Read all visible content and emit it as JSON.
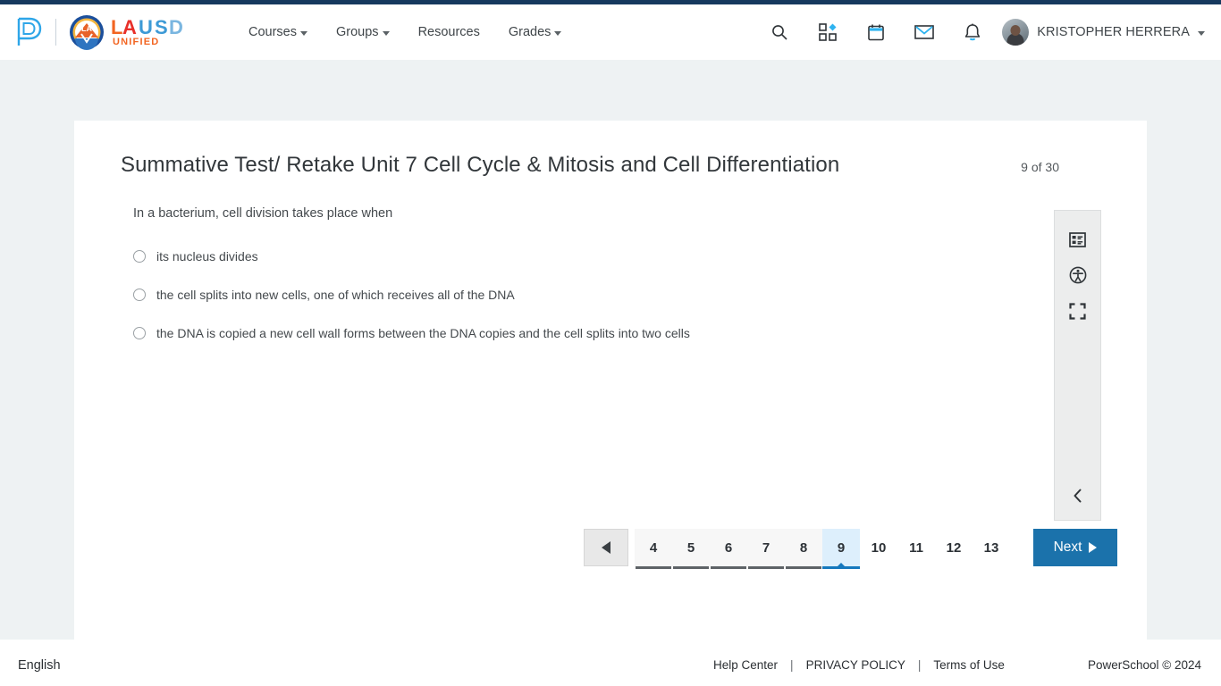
{
  "header": {
    "brand": {
      "powerschool_logo": "powerschool-p-logo",
      "district_logo": "lausd-unified-logo",
      "district_name_primary": "LA",
      "district_name_secondary": "USD",
      "district_tagline": "UNIFIED"
    },
    "nav": [
      {
        "label": "Courses",
        "has_caret": true
      },
      {
        "label": "Groups",
        "has_caret": true
      },
      {
        "label": "Resources",
        "has_caret": false
      },
      {
        "label": "Grades",
        "has_caret": true
      }
    ],
    "icons": [
      {
        "name": "search-icon",
        "title": "Search"
      },
      {
        "name": "apps-grid-icon",
        "title": "Apps"
      },
      {
        "name": "calendar-icon",
        "title": "Calendar"
      },
      {
        "name": "mail-icon",
        "title": "Messages"
      },
      {
        "name": "bell-icon",
        "title": "Notifications"
      }
    ],
    "user": {
      "name": "KRISTOPHER HERRERA",
      "avatar": "user-avatar"
    }
  },
  "quiz": {
    "title": "Summative Test/ Retake Unit 7 Cell Cycle & Mitosis and Cell Differentiation",
    "progress": "9 of 30",
    "current_question": 9,
    "total_questions": 30,
    "question_text": "In a bacterium, cell division takes place when",
    "options": [
      {
        "label": "its nucleus divides",
        "selected": false
      },
      {
        "label": "the cell splits into new cells, one of which receives all of the DNA",
        "selected": false
      },
      {
        "label": "the DNA is copied a new cell wall forms between the DNA copies and the cell splits into two cells",
        "selected": false
      }
    ]
  },
  "tool_rail": {
    "buttons": [
      {
        "name": "question-list-icon",
        "title": "Question list"
      },
      {
        "name": "accessibility-icon",
        "title": "Accessibility"
      },
      {
        "name": "fullscreen-icon",
        "title": "Fullscreen"
      }
    ],
    "collapse": {
      "name": "chevron-left-icon",
      "title": "Collapse panel"
    }
  },
  "pagination": {
    "prev_label": "prev-arrow",
    "pages": [
      {
        "number": "4",
        "state": "answered"
      },
      {
        "number": "5",
        "state": "answered"
      },
      {
        "number": "6",
        "state": "answered"
      },
      {
        "number": "7",
        "state": "answered"
      },
      {
        "number": "8",
        "state": "answered"
      },
      {
        "number": "9",
        "state": "current"
      },
      {
        "number": "10",
        "state": "plain"
      },
      {
        "number": "11",
        "state": "plain"
      },
      {
        "number": "12",
        "state": "plain"
      },
      {
        "number": "13",
        "state": "plain"
      }
    ],
    "next_label": "Next"
  },
  "footer": {
    "language": "English",
    "links": [
      {
        "label": "Help Center"
      },
      {
        "label": "PRIVACY POLICY"
      },
      {
        "label": "Terms of Use"
      }
    ],
    "separator": "|",
    "copyright": "PowerSchool © 2024"
  },
  "colors": {
    "top_strip": "#16395e",
    "accent_blue": "#1b72ab",
    "current_page_bg": "#ddeffc",
    "current_page_underline": "#1578bd",
    "page_bg": "#eef2f3",
    "lausd_orange": "#f26522",
    "lausd_red": "#e8302a",
    "lausd_blue": "#3d9ad6"
  }
}
